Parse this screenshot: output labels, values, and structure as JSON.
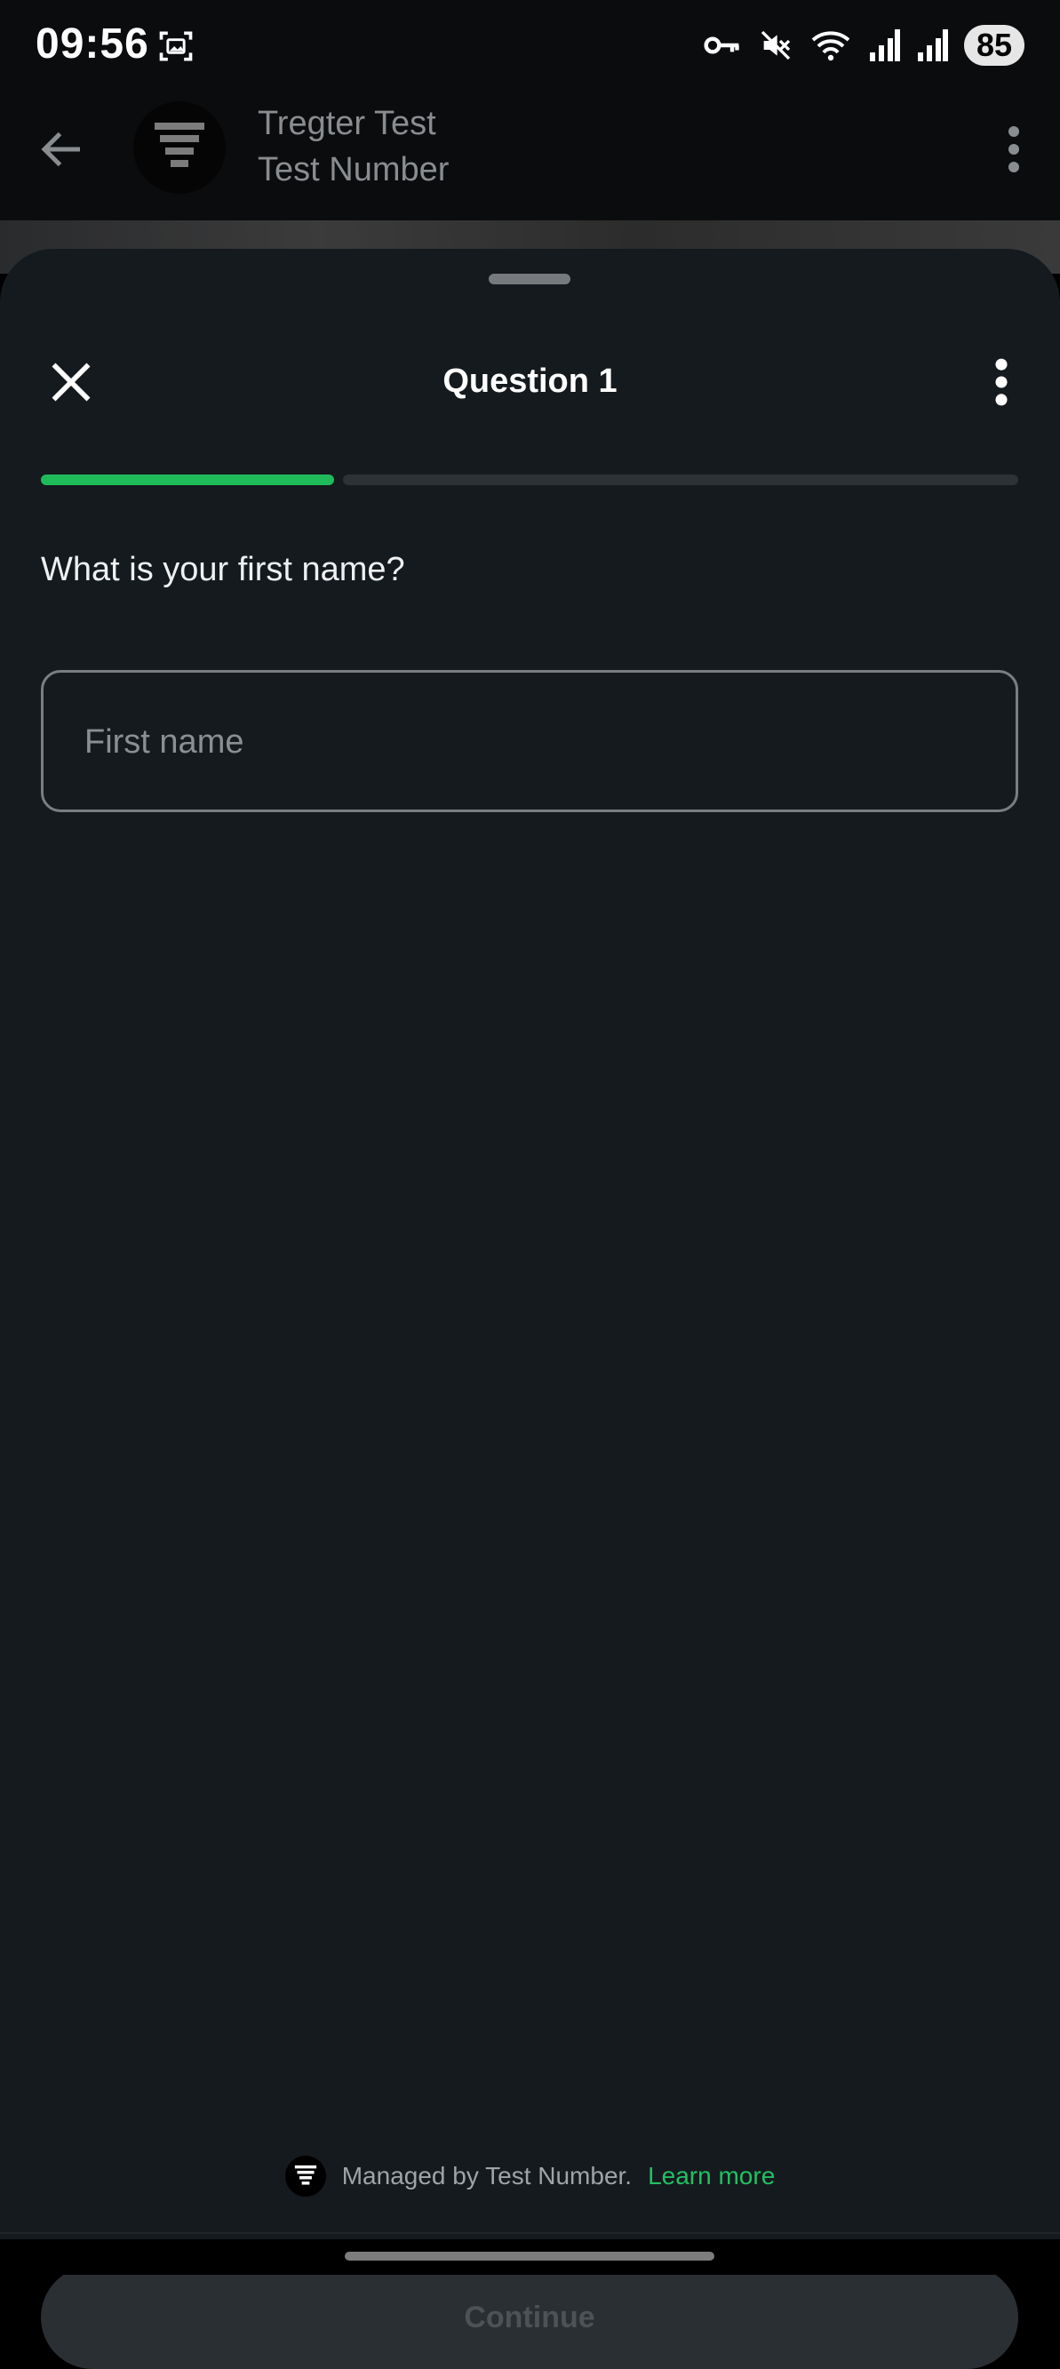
{
  "status_bar": {
    "time": "09:56",
    "battery": "85",
    "icons": [
      "screenshot-icon",
      "vpn-key-icon",
      "mute-icon",
      "wifi-icon",
      "signal-icon",
      "signal-icon"
    ]
  },
  "chat_header": {
    "title": "Tregter Test",
    "subtitle": "Test Number",
    "icons": [
      "back-arrow-icon",
      "avatar",
      "more-vert-icon"
    ]
  },
  "sheet": {
    "title": "Question 1",
    "progress": {
      "completed_fraction": 0.3
    },
    "question": "What is your first name?",
    "first_name_input": {
      "value": "",
      "placeholder": "First name"
    },
    "continue_label": "Continue",
    "managed_text": "Managed by Test Number.",
    "learn_more_label": "Learn more"
  },
  "colors": {
    "accent": "#1fbb5a",
    "sheet_bg": "#151a1e",
    "link": "#21c063"
  }
}
